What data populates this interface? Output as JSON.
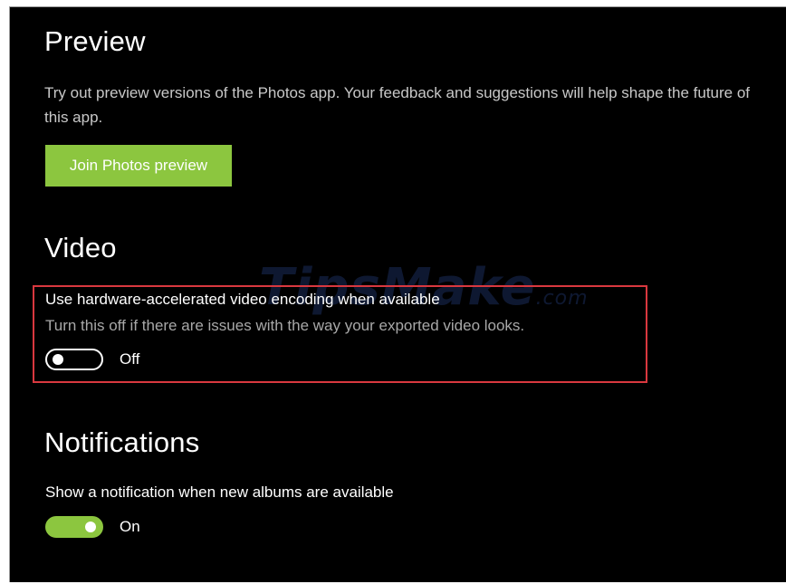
{
  "preview": {
    "heading": "Preview",
    "description": "Try out preview versions of the Photos app. Your feedback and suggestions will help shape the future of this app.",
    "button_label": "Join Photos preview"
  },
  "video": {
    "heading": "Video",
    "setting_label": "Use hardware-accelerated video encoding when available",
    "setting_description": "Turn this off if there are issues with the way your exported video looks.",
    "toggle_state": "Off",
    "toggle_on": false
  },
  "notifications": {
    "heading": "Notifications",
    "setting_label": "Show a notification when new albums are available",
    "toggle_state": "On",
    "toggle_on": true
  },
  "watermark": {
    "text": "TipsMake",
    "suffix": ".com"
  },
  "colors": {
    "background": "#000000",
    "accent": "#8cc63f",
    "highlight_border": "#d9383f"
  }
}
